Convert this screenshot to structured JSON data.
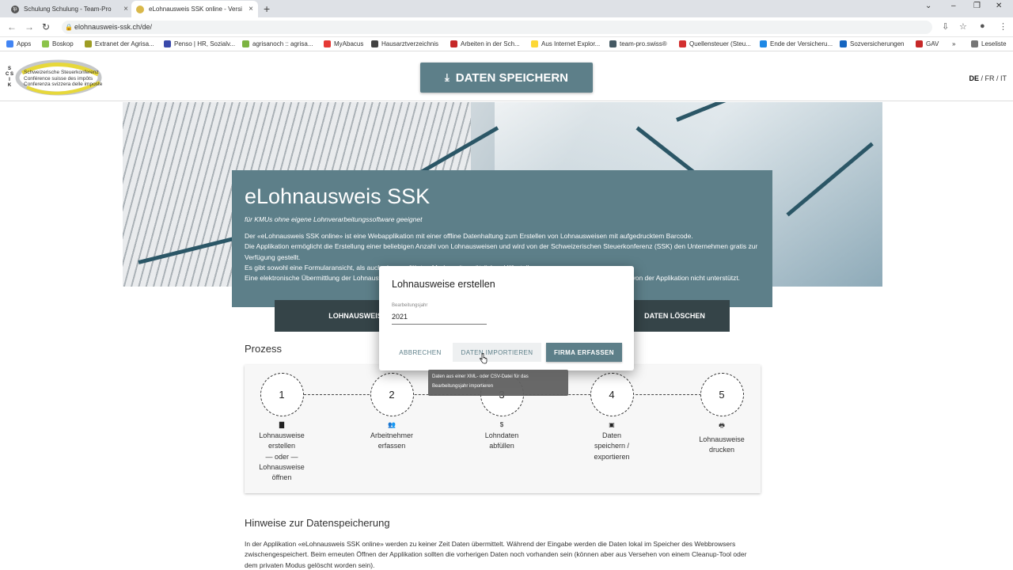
{
  "browser": {
    "tabs": [
      {
        "title": "Schulung Schulung - Team-Pro"
      },
      {
        "title": "eLohnausweis SSK online - Versi"
      }
    ],
    "url": "elohnausweis-ssk.ch/de/",
    "bookmarks": [
      {
        "label": "Apps",
        "color": "#4285f4"
      },
      {
        "label": "Boskop",
        "color": "#8bc34a"
      },
      {
        "label": "Extranet der Agrisa...",
        "color": "#9e9d24"
      },
      {
        "label": "Penso | HR, Sozialv...",
        "color": "#3949ab"
      },
      {
        "label": "agrisanoch :: agrisa...",
        "color": "#7cb342"
      },
      {
        "label": "MyAbacus",
        "color": "#e53935"
      },
      {
        "label": "Hausarztverzeichnis",
        "color": "#424242"
      },
      {
        "label": "Arbeiten in der Sch...",
        "color": "#c62828"
      },
      {
        "label": "Aus Internet Explor...",
        "color": "#fdd835"
      },
      {
        "label": "team-pro.swiss®",
        "color": "#455a64"
      },
      {
        "label": "Quellensteuer (Steu...",
        "color": "#d32f2f"
      },
      {
        "label": "Ende der Versicheru...",
        "color": "#1e88e5"
      },
      {
        "label": "Sozversicherungen",
        "color": "#1565c0"
      },
      {
        "label": "GAV",
        "color": "#c62828"
      },
      {
        "label": "»",
        "color": ""
      },
      {
        "label": "Leseliste",
        "color": "#757575"
      }
    ]
  },
  "header": {
    "logo_ssk": "S\nC S I\nK",
    "logo_lines": [
      "Schweizerische Steuerkonferenz",
      "Conférence suisse des impôts",
      "Conferenza svizzera delle imposte"
    ],
    "save_label": "DATEN SPEICHERN",
    "lang_de": "DE",
    "lang_rest": " / FR / IT"
  },
  "intro": {
    "title": "eLohnausweis SSK",
    "subtitle": "für KMUs ohne eigene Lohnverarbeitungssoftware geeignet",
    "paragraphs": [
      "Der «eLohnausweis SSK online» ist eine Webapplikation mit einer offline Datenhaltung zum Erstellen von Lohnausweisen mit aufgedrucktem Barcode.",
      "Die Applikation ermöglicht die Erstellung einer beliebigen Anzahl von Lohnausweisen und wird von der Schweizerischen Steuerkonferenz (SSK) den Unternehmen gratis zur Verfügung gestellt.",
      "Es gibt sowohl eine Formularansicht, als auch einen geführten Modus mit zusätzlichen Hilfestellungen.",
      "Eine elektronische Übermittlung der Lohnausweise an die Steuerverwaltung über die Lohndatenschnittstelle Swissdec (ELM) wird von der Applikation nicht unterstützt."
    ]
  },
  "actions": {
    "create": "LOHNAUSWEISE ERSTELLEN",
    "delete": "DATEN LÖSCHEN"
  },
  "process": {
    "title": "Prozess",
    "steps": [
      {
        "num": "1",
        "icon": "building-icon",
        "glyph": "▇",
        "label": "Lohnausweise\nerstellen\n— oder —\nLohnausweise\nöffnen"
      },
      {
        "num": "2",
        "icon": "people-icon",
        "glyph": "👥",
        "label": "Arbeitnehmer\nerfassen"
      },
      {
        "num": "3",
        "icon": "dollar-icon",
        "glyph": "$",
        "label": "Lohndaten\nabfüllen"
      },
      {
        "num": "4",
        "icon": "floppy-icon",
        "glyph": "▣",
        "label": "Daten\nspeichern /\nexportieren"
      },
      {
        "num": "5",
        "icon": "printer-icon",
        "glyph": "🖶",
        "label": "Lohnausweise\ndrucken"
      }
    ]
  },
  "hinweise": {
    "title": "Hinweise zur Datenspeicherung",
    "text": "In der Applikation «eLohnausweis SSK online» werden zu keiner Zeit Daten übermittelt. Während der Eingabe werden die Daten lokal im Speicher des Webbrowsers zwischengespeichert. Beim erneuten Öffnen der Applikation sollten die vorherigen Daten noch vorhanden sein (können aber aus Versehen von einem Cleanup-Tool oder dem privaten Modus gelöscht worden sein)."
  },
  "dialog": {
    "title": "Lohnausweise erstellen",
    "field_label": "Bearbeitungsjahr",
    "field_value": "2021",
    "cancel": "ABBRECHEN",
    "import": "DATEN IMPORTIEREN",
    "create_company": "FIRMA ERFASSEN",
    "tooltip": "Daten aus einer XML- oder CSV-Datei für das Bearbeitungsjahr importieren"
  }
}
